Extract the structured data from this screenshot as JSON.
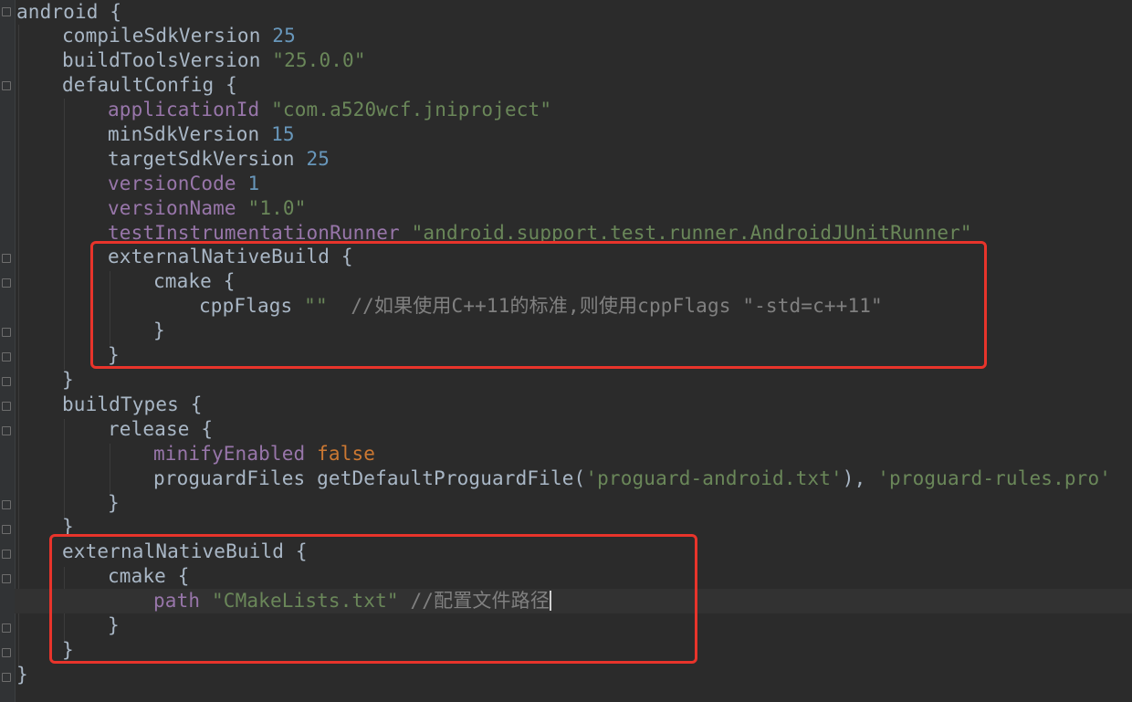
{
  "colors": {
    "background": "#2b2b2b",
    "text": "#a9b7c6",
    "keyword": "#cc7832",
    "number": "#6897bb",
    "string": "#6a8759",
    "property": "#9876aa",
    "comment": "#808080",
    "highlight_box": "#e8342b"
  },
  "code": {
    "l01": {
      "t1": "android {"
    },
    "l02": {
      "t1": "compileSdkVersion",
      "t2": "25"
    },
    "l03": {
      "t1": "buildToolsVersion",
      "t2": "\"25.0.0\""
    },
    "l04": {
      "t1": "defaultConfig {"
    },
    "l05": {
      "t1": "applicationId",
      "t2": "\"com.a520wcf.jniproject\""
    },
    "l06": {
      "t1": "minSdkVersion",
      "t2": "15"
    },
    "l07": {
      "t1": "targetSdkVersion",
      "t2": "25"
    },
    "l08": {
      "t1": "versionCode",
      "t2": "1"
    },
    "l09": {
      "t1": "versionName",
      "t2": "\"1.0\""
    },
    "l10": {
      "t1": "testInstrumentationRunner",
      "t2": "\"android.support.test.runner.AndroidJUnitRunner\""
    },
    "l11": {
      "t1": "externalNativeBuild {"
    },
    "l12": {
      "t1": "cmake {"
    },
    "l13": {
      "t1": "cppFlags",
      "t2": "\"\"",
      "t3": "//如果使用C++11的标准,则使用cppFlags \"-std=c++11\""
    },
    "l14": {
      "t1": "}"
    },
    "l15": {
      "t1": "}"
    },
    "l16": {
      "t1": "}"
    },
    "l17": {
      "t1": "buildTypes {"
    },
    "l18": {
      "t1": "release {"
    },
    "l19": {
      "t1": "minifyEnabled",
      "t2": "false"
    },
    "l20": {
      "t1": "proguardFiles getDefaultProguardFile(",
      "t2": "'proguard-android.txt'",
      "t3": "), ",
      "t4": "'proguard-rules.pro'"
    },
    "l21": {
      "t1": "}"
    },
    "l22": {
      "t1": "}"
    },
    "l23": {
      "t1": "externalNativeBuild {"
    },
    "l24": {
      "t1": "cmake {"
    },
    "l25": {
      "t1": "path",
      "t2": "\"CMakeLists.txt\"",
      "t3": "//配置文件路径"
    },
    "l26": {
      "t1": "}"
    },
    "l27": {
      "t1": "}"
    },
    "l28": {
      "t1": "}"
    }
  }
}
